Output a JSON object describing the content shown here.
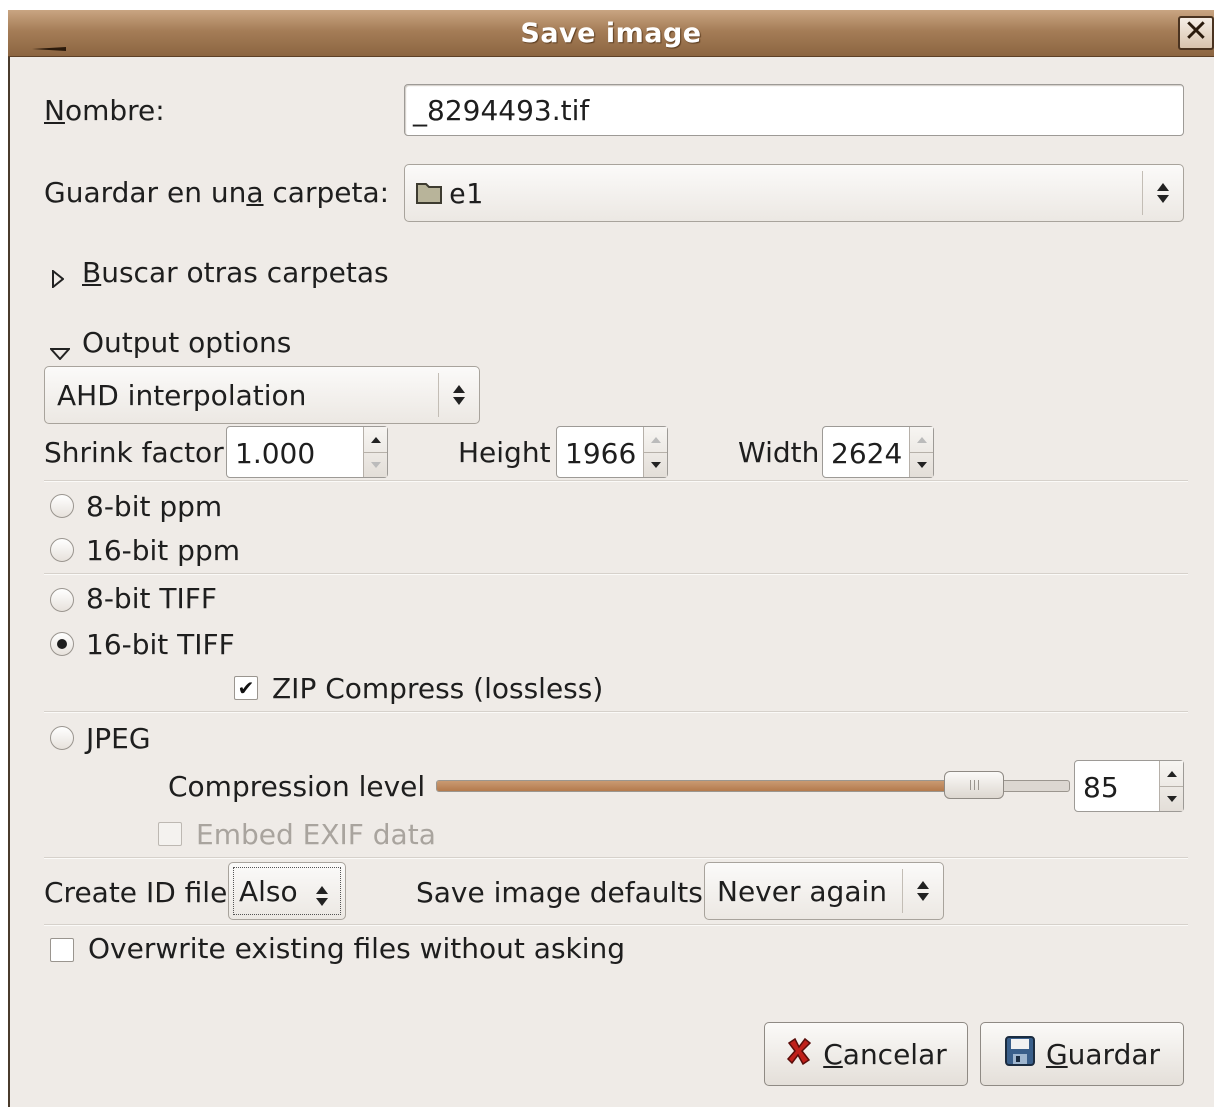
{
  "window": {
    "title": "Save image"
  },
  "name_field": {
    "label": "Nombre:",
    "value": "_8294493.tif"
  },
  "folder": {
    "label": "Guardar en una carpeta:",
    "value": "e1"
  },
  "browse": {
    "label": "Buscar otras carpetas"
  },
  "output": {
    "header": "Output options",
    "interpolation": "AHD interpolation",
    "shrink_label": "Shrink factor",
    "shrink_value": "1.000",
    "height_label": "Height",
    "height_value": "1966",
    "width_label": "Width",
    "width_value": "2624"
  },
  "formats": {
    "ppm8": "8-bit ppm",
    "ppm16": "16-bit ppm",
    "tiff8": "8-bit TIFF",
    "tiff16": "16-bit TIFF",
    "zip": "ZIP Compress (lossless)",
    "jpeg": "JPEG",
    "selected": "16-bit TIFF"
  },
  "jpeg": {
    "compression_label": "Compression level",
    "compression_value": "85",
    "compression_level": 85,
    "exif_label": "Embed EXIF data"
  },
  "id_file": {
    "label": "Create ID file",
    "value": "Also"
  },
  "defaults": {
    "label": "Save image defaults",
    "value": "Never again"
  },
  "overwrite": {
    "label": "Overwrite existing files without asking"
  },
  "buttons": {
    "cancel": "Cancelar",
    "save": "Guardar"
  },
  "colors": {
    "titlebar": "#a57d57",
    "slider_fill": "#b47a4d",
    "dialog_bg": "#efebe7"
  }
}
